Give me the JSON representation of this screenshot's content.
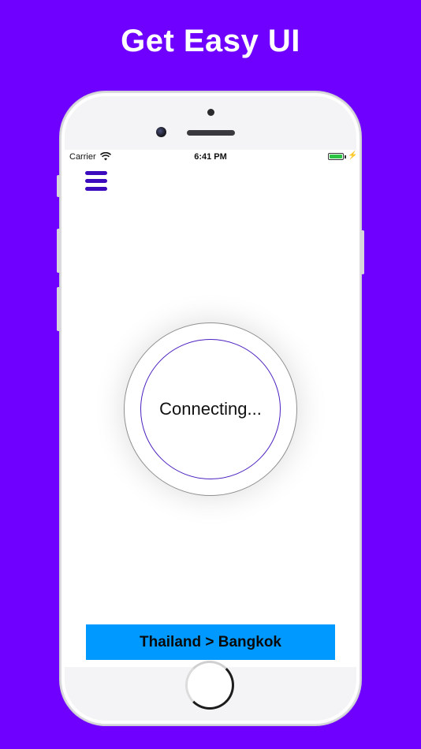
{
  "headline": "Get Easy UI",
  "status_bar": {
    "carrier": "Carrier",
    "time": "6:41 PM",
    "battery_level": 1.0
  },
  "connection": {
    "status_text": "Connecting..."
  },
  "location": {
    "label": "Thailand > Bangkok"
  },
  "colors": {
    "background": "#6F00FF",
    "menu_icon": "#3B0BBD",
    "ring": "#4B1FC0",
    "location_bar": "#0099FF",
    "battery": "#2DC443"
  },
  "icons": {
    "menu": "hamburger-menu-icon",
    "wifi": "wifi-icon",
    "battery": "battery-icon",
    "charging": "charging-bolt-icon"
  }
}
